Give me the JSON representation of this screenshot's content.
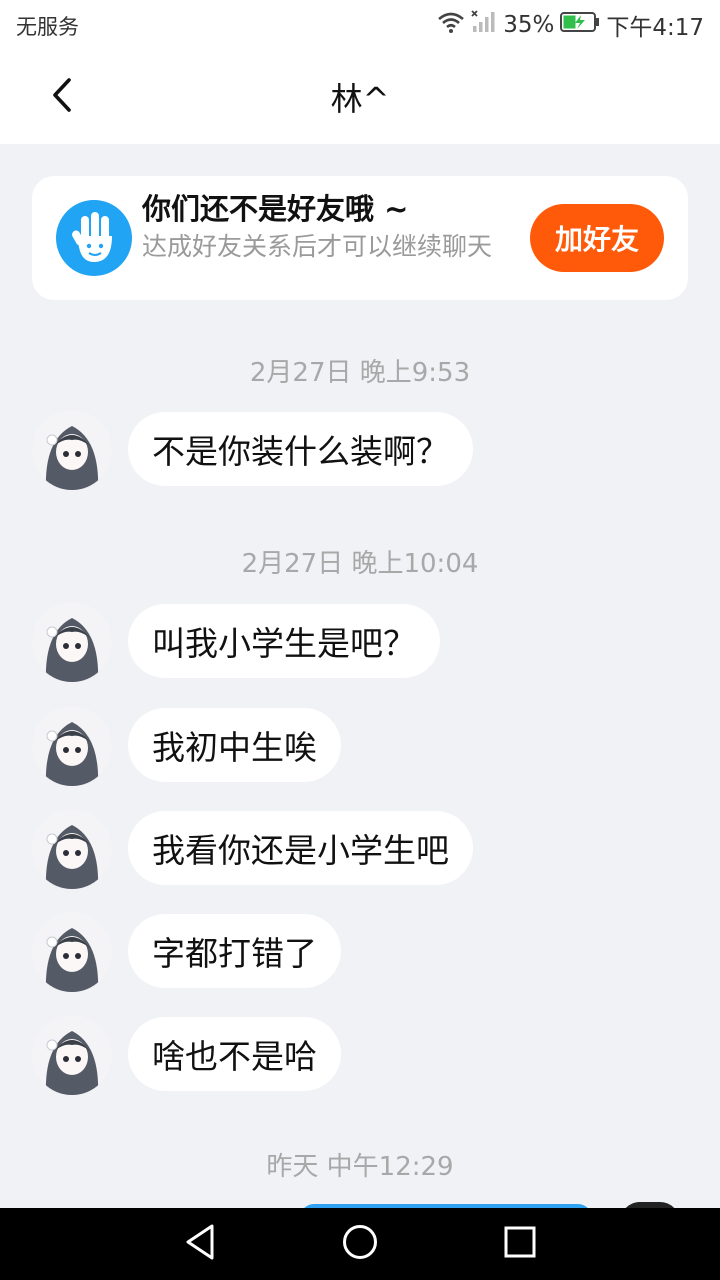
{
  "status_bar": {
    "carrier": "无服务",
    "battery_percent": "35%",
    "time": "下午4:17",
    "icons": [
      "wifi-icon",
      "signal-icon",
      "battery-charging-icon"
    ]
  },
  "header": {
    "title": "林^",
    "back_icon": "chevron-left-icon"
  },
  "friend_notice": {
    "icon": "hand-icon",
    "title": "你们还不是好友哦 ~",
    "subtitle": "达成好友关系后才可以继续聊天",
    "button_label": "加好友",
    "button_color": "#ff5a0a"
  },
  "chat": {
    "groups": [
      {
        "timestamp": "2月27日 晚上9:53",
        "messages": [
          "不是你装什么装啊？"
        ]
      },
      {
        "timestamp": "2月27日 晚上10:04",
        "messages": [
          "叫我小学生是吧？",
          "我初中生唉",
          "我看你还是小学生吧",
          "字都打错了",
          "啥也不是哈"
        ]
      },
      {
        "timestamp": "昨天 中午12:29",
        "messages": []
      }
    ]
  },
  "system_nav": {
    "buttons": [
      "back-triangle-icon",
      "home-circle-icon",
      "recents-square-icon"
    ]
  },
  "colors": {
    "background": "#f1f2f6",
    "accent_blue": "#20a4f3",
    "sent_bubble": "#2fa2f4"
  }
}
